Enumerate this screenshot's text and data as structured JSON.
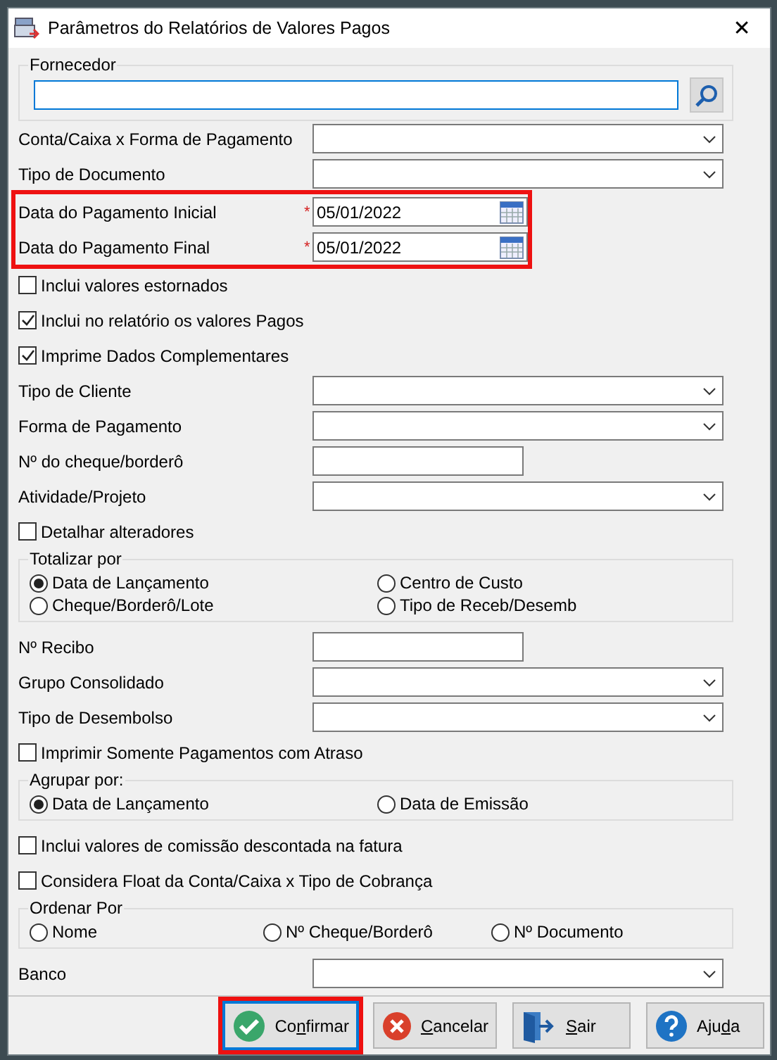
{
  "window": {
    "title": "Parâmetros do Relatórios de Valores Pagos",
    "close": "✕"
  },
  "supplier": {
    "legend": "Fornecedor",
    "focused": true
  },
  "items": [
    {
      "kind": "combo",
      "label": "Conta/Caixa x Forma de Pagamento"
    },
    {
      "kind": "combo",
      "label": "Tipo de Documento"
    },
    {
      "kind": "highlight",
      "highlighted": true,
      "rows": [
        {
          "kind": "date",
          "label": "Data do Pagamento Inicial",
          "required_mark": "*",
          "value": "05/01/2022"
        },
        {
          "kind": "date",
          "label": "Data do Pagamento Final",
          "required_mark": "*",
          "value": "05/01/2022"
        }
      ]
    },
    {
      "kind": "checkbox",
      "label": "Inclui valores estornados",
      "checked": false
    },
    {
      "kind": "checkbox",
      "label": "Inclui no relatório os valores Pagos",
      "checked": true
    },
    {
      "kind": "checkbox",
      "label": "Imprime Dados Complementares",
      "checked": true
    },
    {
      "kind": "combo",
      "label": "Tipo de Cliente"
    },
    {
      "kind": "combo",
      "label": "Forma de Pagamento"
    },
    {
      "kind": "text",
      "label": "Nº do cheque/borderô"
    },
    {
      "kind": "combo",
      "label": "Atividade/Projeto"
    },
    {
      "kind": "checkbox",
      "label": "Detalhar alteradores",
      "checked": false
    },
    {
      "kind": "radios",
      "legend": "Totalizar por",
      "options": [
        {
          "label": "Data de Lançamento",
          "selected": true
        },
        {
          "label": "Centro de Custo",
          "selected": false
        },
        {
          "label": "Cheque/Borderô/Lote",
          "selected": false
        },
        {
          "label": "Tipo de Receb/Desemb",
          "selected": false
        }
      ]
    },
    {
      "kind": "text",
      "label": "Nº Recibo"
    },
    {
      "kind": "combo",
      "label": "Grupo Consolidado"
    },
    {
      "kind": "combo",
      "label": "Tipo de Desembolso"
    },
    {
      "kind": "checkbox",
      "label": "Imprimir Somente Pagamentos com Atraso",
      "checked": false
    },
    {
      "kind": "radios",
      "legend": "Agrupar por:",
      "options": [
        {
          "label": "Data de Lançamento",
          "selected": true
        },
        {
          "label": "Data de Emissão",
          "selected": false
        }
      ]
    },
    {
      "kind": "checkbox",
      "label": "Inclui valores de comissão descontada na fatura",
      "checked": false
    },
    {
      "kind": "checkbox",
      "label": "Considera Float da Conta/Caixa x Tipo de Cobrança",
      "checked": false
    },
    {
      "kind": "radios",
      "legend": "Ordenar Por",
      "options": [
        {
          "label": "Nome",
          "selected": false
        },
        {
          "label": "Nº Cheque/Borderô",
          "selected": false
        },
        {
          "label": "Nº Documento",
          "selected": false
        }
      ]
    },
    {
      "kind": "combo",
      "label": "Banco"
    }
  ],
  "buttons": [
    {
      "kind": "confirm",
      "before": "Co",
      "key": "n",
      "after": "firmar",
      "highlighted": true
    },
    {
      "kind": "cancel",
      "key": "C",
      "after": "ancelar",
      "highlighted": false
    },
    {
      "kind": "exit",
      "key": "S",
      "after": "air",
      "highlighted": false
    },
    {
      "kind": "help",
      "before": "Aju",
      "key": "d",
      "after": "a",
      "highlighted": false
    }
  ]
}
